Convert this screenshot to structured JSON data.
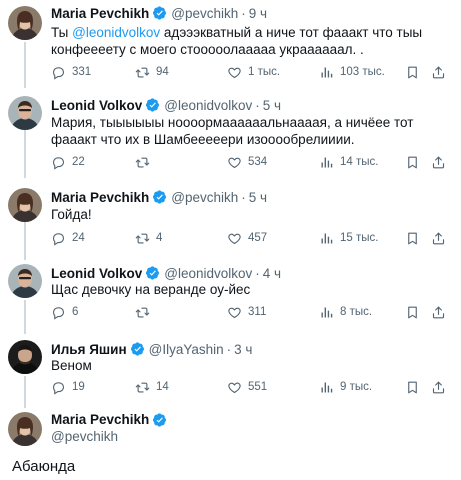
{
  "tweets": [
    {
      "name": "Maria Pevchikh",
      "handle": "@pevchikh",
      "sep": "·",
      "time": "9 ч",
      "text_before": "Ты ",
      "mention": "@leonidvolkov",
      "text_after": " адэээкватный а ниче тот фааакт что тыы конфеееету с моего стооооолааааа украааааал. .",
      "replies": "331",
      "retweets": "94",
      "likes": "1 тыс.",
      "views": "103 тыс.",
      "avatar": "woman-avatar"
    },
    {
      "name": "Leonid Volkov",
      "handle": "@leonidvolkov",
      "sep": "·",
      "time": "5 ч",
      "text": "Мария, тыыыыыы ноооормаааааальнаааая, а ничёее тот фааакт что их в Шамбееееери изооообрелииии.",
      "replies": "22",
      "retweets": "",
      "likes": "534",
      "views": "14 тыс.",
      "avatar": "man-avatar"
    },
    {
      "name": "Maria Pevchikh",
      "handle": "@pevchikh",
      "sep": "·",
      "time": "5 ч",
      "text": "Гойда!",
      "replies": "24",
      "retweets": "4",
      "likes": "457",
      "views": "15 тыс.",
      "avatar": "woman-avatar"
    },
    {
      "name": "Leonid Volkov",
      "handle": "@leonidvolkov",
      "sep": "·",
      "time": "4 ч",
      "text": "Щас девочку на веранде оу-йес",
      "replies": "6",
      "retweets": "",
      "likes": "311",
      "views": "8 тыс.",
      "avatar": "man-avatar"
    },
    {
      "name": "Илья Яшин",
      "handle": "@IlyaYashin",
      "sep": "·",
      "time": "3 ч",
      "text": "Веном",
      "replies": "19",
      "retweets": "14",
      "likes": "551",
      "views": "9 тыс.",
      "avatar": "man-avatar-dark"
    }
  ],
  "main_tweet": {
    "name": "Maria Pevchikh",
    "handle": "@pevchikh",
    "text": "Абаюнда"
  },
  "colors": {
    "accent": "#1d9bf0",
    "secondary_text": "#536471",
    "thread_line": "#cfd9de",
    "verified": "#1d9bf0"
  },
  "icons": [
    "reply-icon",
    "retweet-icon",
    "like-icon",
    "views-icon",
    "bookmark-icon",
    "share-icon",
    "verified-badge-icon"
  ]
}
